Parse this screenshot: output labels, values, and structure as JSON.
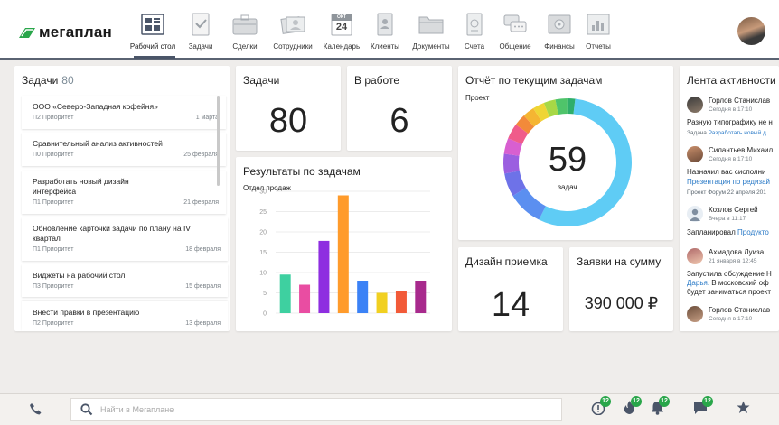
{
  "app": {
    "logo_text": "мегаплан"
  },
  "nav": [
    {
      "id": "desk",
      "label": "Рабочий стол",
      "icon": "desktop-icon",
      "active": true
    },
    {
      "id": "tasks",
      "label": "Задачи",
      "icon": "checklist-icon"
    },
    {
      "id": "deals",
      "label": "Сделки",
      "icon": "briefcase-icon"
    },
    {
      "id": "staff",
      "label": "Сотрудники",
      "icon": "people-icon"
    },
    {
      "id": "cal",
      "label": "Календарь",
      "icon": "calendar-icon",
      "cal_month": "ОКТ",
      "cal_day": "24"
    },
    {
      "id": "clients",
      "label": "Клиенты",
      "icon": "contacts-icon"
    },
    {
      "id": "docs",
      "label": "Документы",
      "icon": "folder-icon"
    },
    {
      "id": "bills",
      "label": "Счета",
      "icon": "invoice-icon"
    },
    {
      "id": "comm",
      "label": "Общение",
      "icon": "chat-icon"
    },
    {
      "id": "fin",
      "label": "Финансы",
      "icon": "safe-icon"
    },
    {
      "id": "reports",
      "label": "Отчеты",
      "icon": "report-icon"
    }
  ],
  "tasks_list": {
    "title": "Задачи",
    "count": "80",
    "items": [
      {
        "title": "ООО «Северо-Западная кофейня»",
        "priority": "П2 Приоритет",
        "date": "1 марта"
      },
      {
        "title": "Сравнительный анализ активностей",
        "priority": "П0 Приоритет",
        "date": "25 февраля"
      },
      {
        "title": "Разработать новый дизайн интерфейса",
        "priority": "П1 Приоритет",
        "date": "21 февраля"
      },
      {
        "title": "Обновление карточки задачи по плану на IV квартал",
        "priority": "П1 Приоритет",
        "date": "18 февраля"
      },
      {
        "title": "Виджеты на рабочий стол",
        "priority": "П3 Приоритет",
        "date": "15 февраля"
      },
      {
        "title": "Внести правки в презентацию",
        "priority": "П2 Приоритет",
        "date": "13 февраля"
      }
    ]
  },
  "widgets": {
    "tasks": {
      "title": "Задачи",
      "value": "80"
    },
    "in_work": {
      "title": "В работе",
      "value": "6"
    },
    "design": {
      "title": "Дизайн приемка",
      "value": "14"
    },
    "sum": {
      "title": "Заявки на сумму",
      "value": "390 000 ₽"
    }
  },
  "chart_data": [
    {
      "type": "bar",
      "title": "Результаты по задачам",
      "subtitle": "Отдел продаж",
      "ylim": [
        0,
        30
      ],
      "yticks": [
        0,
        5,
        10,
        15,
        20,
        25,
        30
      ],
      "values": [
        9.5,
        7,
        17.8,
        29,
        8,
        5,
        5.5,
        8
      ],
      "colors": [
        "#3ed0a0",
        "#e94da2",
        "#8e2ee0",
        "#ff9b2b",
        "#3b82f6",
        "#f1d021",
        "#f25a38",
        "#a82a8d"
      ],
      "grid": true
    },
    {
      "type": "pie",
      "title": "Отчёт по текущим задачам",
      "subtitle": "Проект",
      "center_value": "59",
      "center_label": "задач",
      "slices": [
        {
          "value": 56,
          "color": "#5fccf5"
        },
        {
          "value": 9,
          "color": "#5b8ff0"
        },
        {
          "value": 6,
          "color": "#6e72e8"
        },
        {
          "value": 5,
          "color": "#9b5fe0"
        },
        {
          "value": 4,
          "color": "#d85fd0"
        },
        {
          "value": 4,
          "color": "#f05c8a"
        },
        {
          "value": 3,
          "color": "#f28a3a"
        },
        {
          "value": 3,
          "color": "#f5b532"
        },
        {
          "value": 3,
          "color": "#efd534"
        },
        {
          "value": 3,
          "color": "#a7d846"
        },
        {
          "value": 3,
          "color": "#4fc46a"
        },
        {
          "value": 2,
          "color": "#2fae6a"
        }
      ]
    }
  ],
  "feed": {
    "title": "Лента активности",
    "items": [
      {
        "name": "Горлов Станислав",
        "time": "Сегодня в 17:10",
        "text": "Разную типографику не н",
        "sub_prefix": "Задача",
        "sub_link": "Разработать новый д"
      },
      {
        "name": "Силантьев Михаил",
        "time": "Сегодня в 17:10",
        "text": "Назначил вас сисполни",
        "link": "Презентация по редизай",
        "sub_prefix": "Проект Форум 22 апреля 201"
      },
      {
        "name": "Козлов Сергей",
        "time": "Вчера в 11:17",
        "text_prefix": "Запланировал",
        "link": "Продукто"
      },
      {
        "name": "Ахмадова Луиза",
        "time": "21 января в 12:45",
        "text": "Запустила обсуждение Н",
        "link": "Дарья.",
        "text2": "В московский оф",
        "text3": "будет заниматься проект"
      },
      {
        "name": "Горлов Станислав",
        "time": "Сегодня в 17:10"
      }
    ]
  },
  "bottom": {
    "search_placeholder": "Найти в Мегаплане",
    "badges": {
      "alerts": "12",
      "fire": "12",
      "bell": "12",
      "chat": "12"
    }
  },
  "colors": {
    "accent": "#29a64a",
    "link": "#2a7ac7"
  }
}
